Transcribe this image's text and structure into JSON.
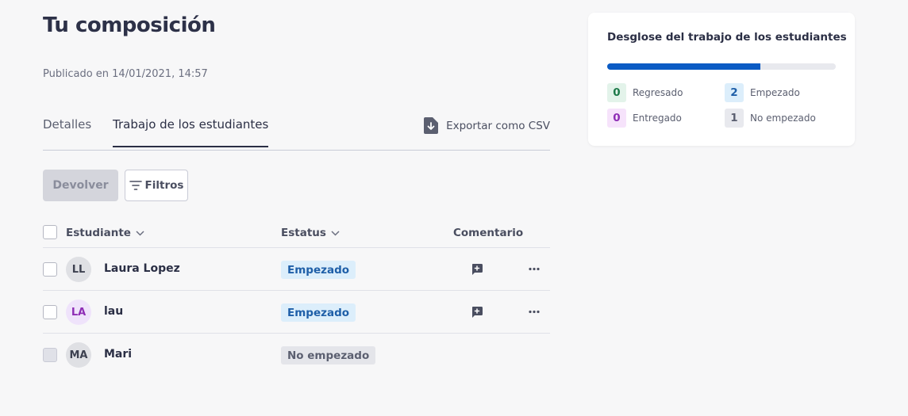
{
  "page": {
    "title": "Tu composición",
    "published": "Publicado en 14/01/2021, 14:57"
  },
  "tabs": [
    {
      "label": "Detalles",
      "active": false
    },
    {
      "label": "Trabajo de los estudiantes",
      "active": true
    }
  ],
  "export_label": "Exportar como CSV",
  "toolbar": {
    "return_label": "Devolver",
    "filters_label": "Filtros"
  },
  "table": {
    "headers": {
      "student": "Estudiante",
      "status": "Estatus",
      "comment": "Comentario"
    },
    "rows": [
      {
        "initials": "LL",
        "name": "Laura Lopez",
        "status": "Empezado",
        "has_comment": true
      },
      {
        "initials": "LA",
        "name": "lau",
        "status": "Empezado",
        "has_comment": true
      },
      {
        "initials": "MA",
        "name": "Mari",
        "status": "No empezado",
        "has_comment": false
      }
    ]
  },
  "breakdown": {
    "title": "Desglose del trabajo de los estudiantes",
    "progress_fraction": 0.67,
    "stats": [
      {
        "count": "0",
        "label": "Regresado",
        "color": "#1e7a4a",
        "bg": "#e3f3ea"
      },
      {
        "count": "2",
        "label": "Empezado",
        "color": "#1f5fa8",
        "bg": "#dceefb"
      },
      {
        "count": "0",
        "label": "Entregado",
        "color": "#8e2db5",
        "bg": "#f6e3fb"
      },
      {
        "count": "1",
        "label": "No empezado",
        "color": "#5b5f70",
        "bg": "#e8e9ee"
      }
    ]
  },
  "colors": {
    "accent": "#0a5bc4",
    "avatar_ll_bg": "#dfe0e4",
    "avatar_la_bg": "#efe3fb",
    "avatar_la_fg": "#8e2db5",
    "avatar_ma_bg": "#dfe0e4"
  },
  "icons": {
    "export": "download-file-icon",
    "filters": "filter-lines-icon",
    "sort": "chevron-down-icon",
    "comment": "add-comment-icon",
    "more": "more-horizontal-icon"
  }
}
